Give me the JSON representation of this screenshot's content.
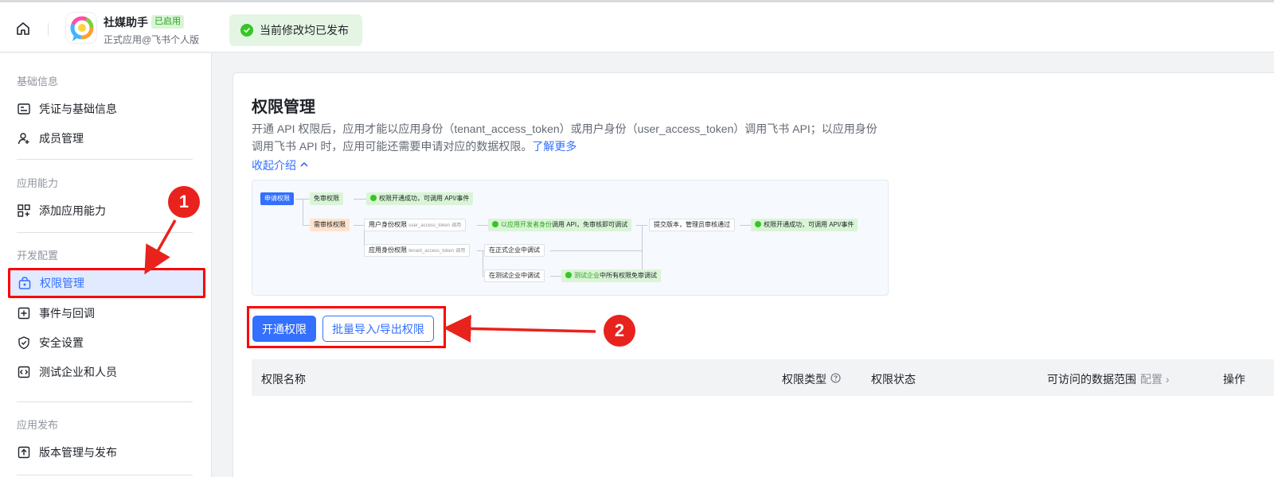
{
  "topbar": {
    "app_name": "社媒助手",
    "app_badge": "已启用",
    "app_sub": "正式应用@飞书个人版",
    "publish_status": "当前修改均已发布"
  },
  "sidebar": {
    "sections": [
      {
        "title": "基础信息",
        "items": [
          {
            "label": "凭证与基础信息",
            "icon": "id-card-icon"
          },
          {
            "label": "成员管理",
            "icon": "add-member-icon"
          }
        ]
      },
      {
        "title": "应用能力",
        "items": [
          {
            "label": "添加应用能力",
            "icon": "add-app-icon"
          }
        ]
      },
      {
        "title": "开发配置",
        "items": [
          {
            "label": "权限管理",
            "icon": "lock-bag-icon",
            "active": true
          },
          {
            "label": "事件与回调",
            "icon": "event-icon"
          },
          {
            "label": "安全设置",
            "icon": "shield-icon"
          },
          {
            "label": "测试企业和人员",
            "icon": "code-icon"
          }
        ]
      },
      {
        "title": "应用发布",
        "items": [
          {
            "label": "版本管理与发布",
            "icon": "upload-icon"
          }
        ]
      }
    ]
  },
  "main": {
    "title": "权限管理",
    "desc_line1": "开通 API 权限后，应用才能以应用身份（tenant_access_token）或用户身份（user_access_token）调用飞书 API；以应用身份",
    "desc_line2": "调用飞书 API 时，应用可能还需要申请对应的数据权限。",
    "learn_more": "了解更多",
    "collapse_label": "收起介绍",
    "flow": {
      "apply": "申请权限",
      "no_review": "免审权限",
      "success": "权限开通成功，可调用 API/事件",
      "need_review": "需审核权限",
      "user_perm": "用户身份权限",
      "user_token": "user_access_token",
      "call": "调用",
      "dev_call_a": "以应用开发者身份",
      "dev_call_b": "调用 API，免审核即可调试",
      "submit": "提交版本，管理员审核通过",
      "app_perm": "应用身份权限",
      "tenant_token": "tenant_access_token",
      "prod_debug": "在正式企业中调试",
      "test_debug": "在测试企业中调试",
      "test_a": "测试企业",
      "test_b": "中所有权限免审调试"
    },
    "btn_open": "开通权限",
    "btn_batch": "批量导入/导出权限",
    "table_headers": {
      "name": "权限名称",
      "type": "权限类型",
      "status": "权限状态",
      "scope": "可访问的数据范围",
      "scope_config": "配置",
      "action": "操作"
    }
  },
  "annotations": {
    "one": "1",
    "two": "2"
  }
}
